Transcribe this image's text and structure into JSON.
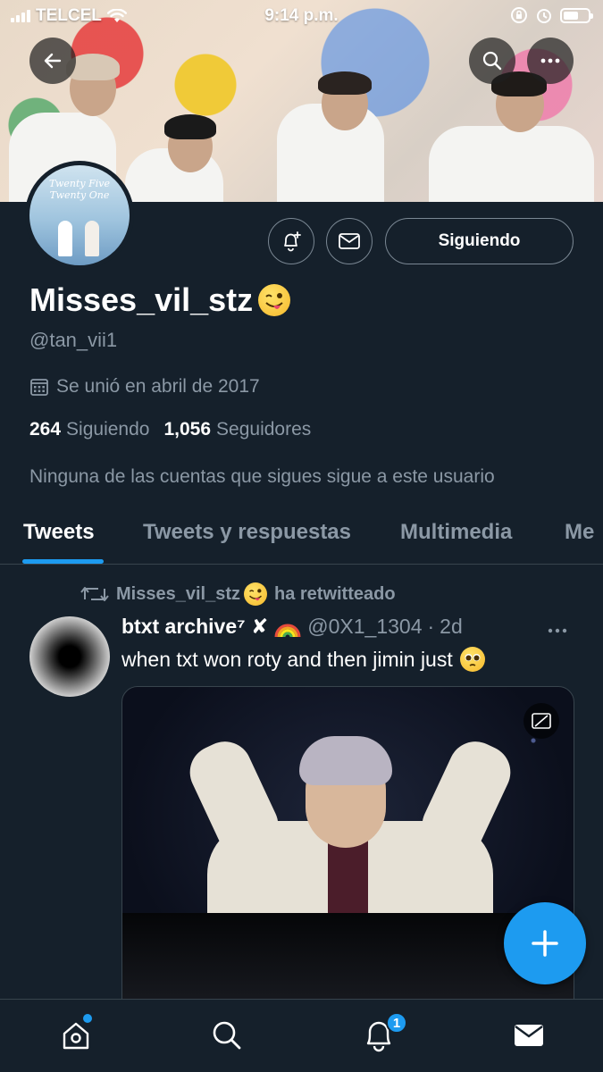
{
  "status_bar": {
    "carrier": "TELCEL",
    "time": "9:14 p.m."
  },
  "profile": {
    "display_name": "Misses_vil_stz",
    "handle": "@tan_vii1",
    "joined": "Se unió en abril de 2017",
    "following_count": "264",
    "following_label": "Siguiendo",
    "followers_count": "1,056",
    "followers_label": "Seguidores",
    "mutual_note": "Ninguna de las cuentas que sigues sigue a este usuario",
    "follow_button": "Siguiendo",
    "avatar_text": "Twenty Five Twenty One"
  },
  "tabs": [
    {
      "label": "Tweets",
      "active": true
    },
    {
      "label": "Tweets y respuestas",
      "active": false
    },
    {
      "label": "Multimedia",
      "active": false
    },
    {
      "label": "Me",
      "active": false
    }
  ],
  "tweet": {
    "retweet_by": "Misses_vil_stz",
    "retweet_suffix": "ha retwitteado",
    "author_name": "btxt archive⁷ ✘",
    "author_handle": "@0X1_1304",
    "separator": "·",
    "time": "2d",
    "text": "when txt won roty and then jimin just"
  },
  "nav": {
    "notification_badge": "1"
  },
  "colors": {
    "background": "#15202b",
    "accent": "#1d9bf0",
    "secondary_text": "#8b98a5",
    "divider": "#38444d"
  },
  "icons": [
    "back-arrow-icon",
    "search-icon",
    "more-icon",
    "bell-plus-icon",
    "mail-icon",
    "calendar-icon",
    "retweet-icon",
    "wink-tongue-emoji",
    "rainbow-emoji",
    "pleading-emoji",
    "cc-icon",
    "plus-icon",
    "home-icon",
    "search-icon",
    "bell-icon",
    "mail-icon"
  ]
}
